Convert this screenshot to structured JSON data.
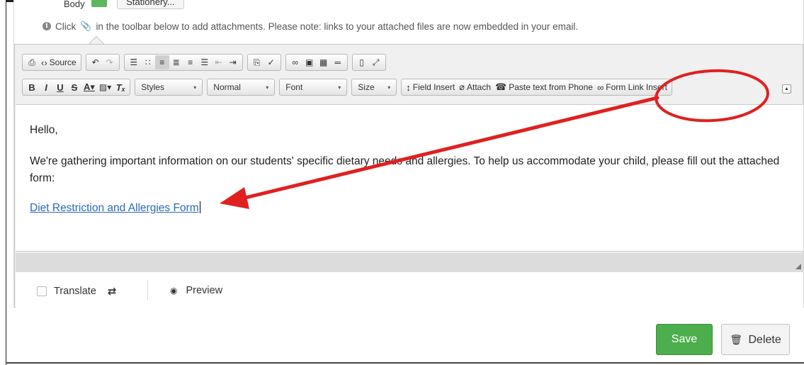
{
  "header": {
    "body_label": "Body",
    "stationery_label": "Stationery..."
  },
  "info": {
    "text_before": "Click",
    "text_after": "in the toolbar below to add attachments. Please note: links to your attached files are now embedded in your email."
  },
  "toolbar": {
    "source_label": "Source",
    "styles_label": "Styles",
    "format_label": "Normal",
    "font_label": "Font",
    "size_label": "Size",
    "field_insert_label": "Field Insert",
    "attach_label": "Attach",
    "paste_phone_label": "Paste text from Phone",
    "form_link_label": "Form Link Insert"
  },
  "content": {
    "greeting": "Hello,",
    "message": "We're gathering important information on our students' specific dietary needs and allergies. To help us accommodate your child, please fill out the attached form:",
    "form_link": "Diet Restriction and Allergies Form"
  },
  "options": {
    "translate_label": "Translate",
    "preview_label": "Preview"
  },
  "actions": {
    "save_label": "Save",
    "delete_label": "Delete"
  },
  "colors": {
    "save": "#4cae4c",
    "link": "#2a6aba",
    "annotation": "#e02020"
  }
}
